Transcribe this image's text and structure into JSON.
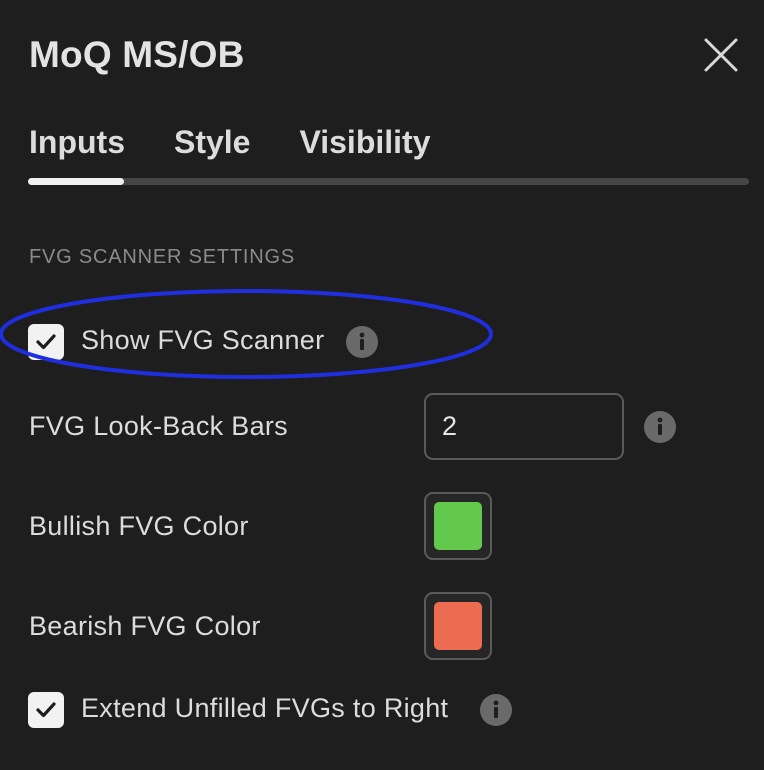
{
  "dialog": {
    "title": "MoQ MS/OB"
  },
  "tabs": [
    {
      "label": "Inputs"
    },
    {
      "label": "Style"
    },
    {
      "label": "Visibility"
    }
  ],
  "active_tab": "Inputs",
  "section": {
    "heading": "FVG SCANNER SETTINGS"
  },
  "inputs": {
    "show_fvg_scanner": {
      "label": "Show FVG Scanner",
      "checked": true
    },
    "lookback": {
      "label": "FVG Look-Back Bars",
      "value": "2"
    },
    "bullish_color": {
      "label": "Bullish FVG Color",
      "color": "#63c94d"
    },
    "bearish_color": {
      "label": "Bearish FVG Color",
      "color": "#ec6c52"
    },
    "extend_unfilled": {
      "label": "Extend Unfilled FVGs to Right",
      "checked": true
    }
  },
  "icons": {
    "close": "close-icon",
    "info": "info-icon",
    "check": "checkmark-icon"
  },
  "colors": {
    "background": "#1e1e1e",
    "annotation_ellipse": "#1f2fe0"
  }
}
